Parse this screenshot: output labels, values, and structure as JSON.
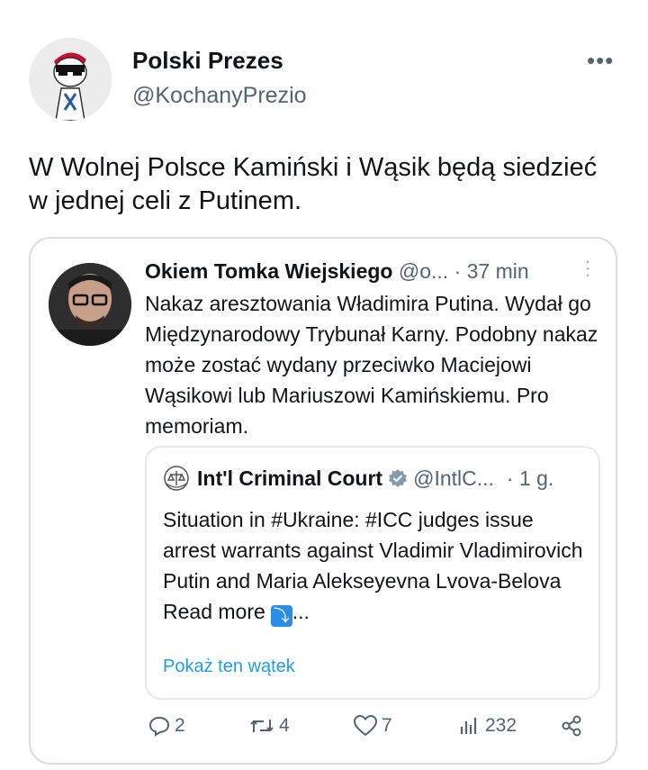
{
  "post": {
    "author_name": "Polski Prezes",
    "author_handle": "@KochanyPrezio",
    "more_icon": "more-horizontal-icon",
    "text": "W Wolnej Polsce Kamiński i Wąsik będą siedzieć w jednej celi z Putinem."
  },
  "quoted": {
    "author_name": "Okiem Tomka Wiejskiego",
    "author_handle": "@o...",
    "time": "· 37 min",
    "text": "Nakaz aresztowania Władimira Putina. Wydał go Międzynarodowy Trybunał Karny. Podobny nakaz może zostać wydany przeciwko Maciejowi Wąsikowi lub Mariuszowi Kamińskiemu. Pro memoriam.",
    "nested": {
      "author_name": "Int'l Criminal Court",
      "author_handle": "@IntlC...",
      "time": "· 1 g.",
      "text": "Situation in #Ukraine: #ICC judges issue arrest warrants against Vladimir Vladimirovich Putin and Maria Alekseyevna Lvova-Belova",
      "read_more": "Read more",
      "read_more_suffix": "...",
      "show_thread": "Pokaż ten wątek"
    },
    "actions": {
      "replies": "2",
      "reposts": "4",
      "likes": "7",
      "views": "232"
    }
  },
  "colors": {
    "accent": "#1d9bf0",
    "muted": "#536471",
    "border": "#d8dee2"
  }
}
